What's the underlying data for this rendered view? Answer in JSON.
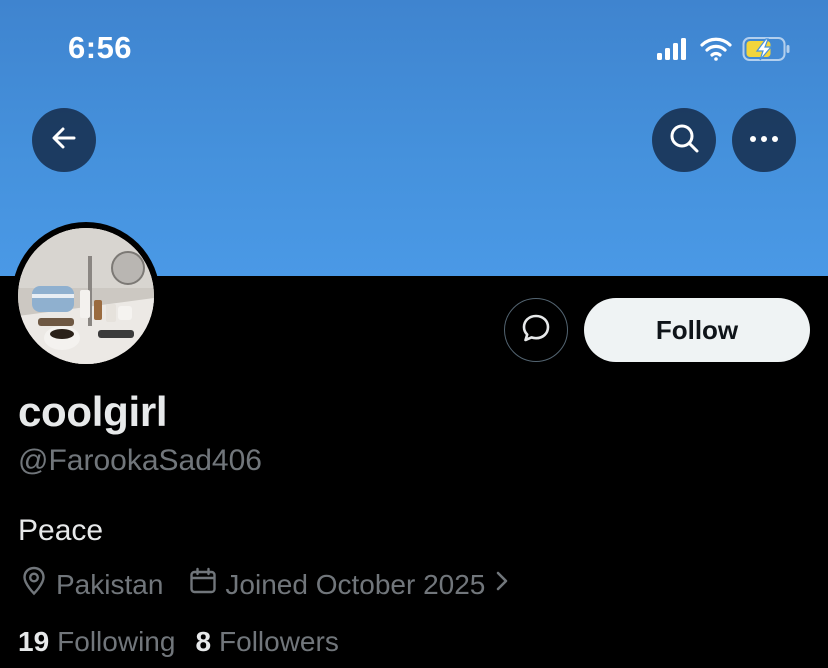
{
  "status_bar": {
    "time": "6:56",
    "icons": [
      "cellular-signal-icon",
      "wifi-icon",
      "battery-charging-icon"
    ]
  },
  "header": {
    "back_icon": "arrow-left-icon",
    "search_icon": "search-icon",
    "more_icon": "more-horizontal-icon"
  },
  "profile": {
    "display_name": "coolgirl",
    "handle": "@FarookaSad406",
    "bio": "Peace",
    "location": "Pakistan",
    "joined": "Joined October 2025",
    "following_count": "19",
    "following_label": "Following",
    "followers_count": "8",
    "followers_label": "Followers"
  },
  "actions": {
    "follow_label": "Follow",
    "message_icon": "message-bubble-icon"
  },
  "colors": {
    "banner": "#4591dc",
    "background": "#000000",
    "primary_text": "#e7e9ea",
    "secondary_text": "#71767b",
    "follow_bg": "#eff3f4"
  }
}
